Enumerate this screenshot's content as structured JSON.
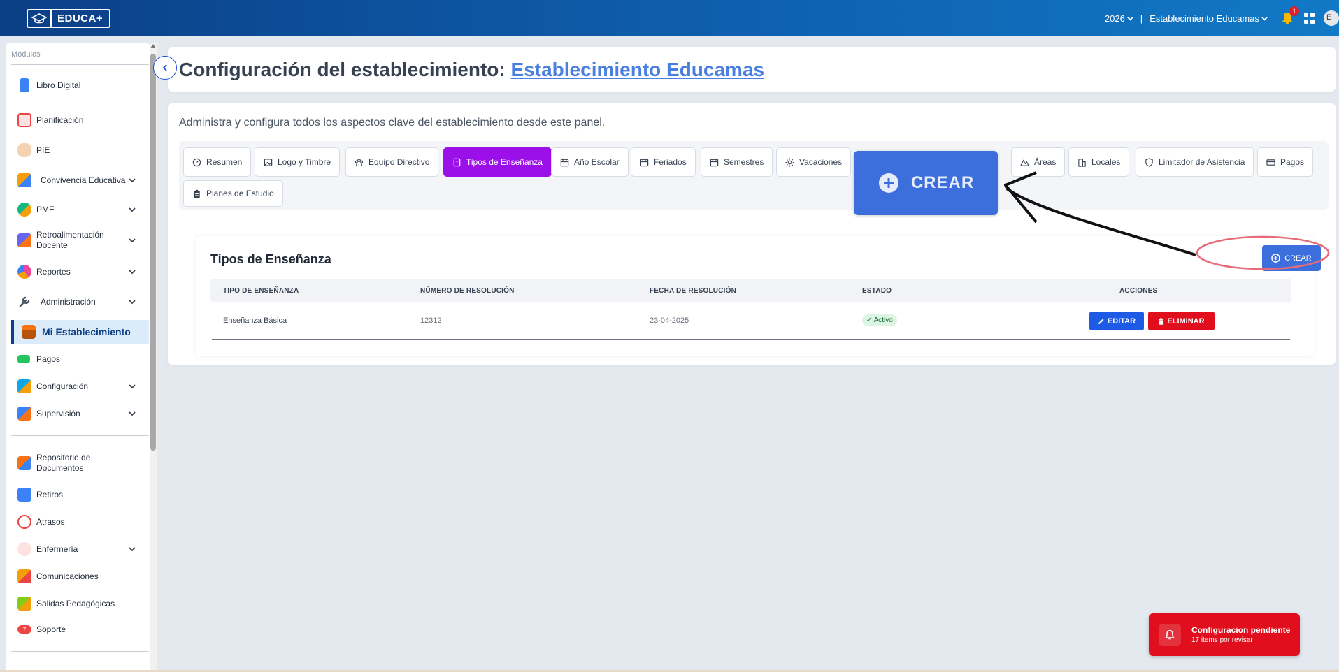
{
  "app": {
    "logo_text": "EDUCA+"
  },
  "topbar": {
    "year": "2026",
    "separator": "|",
    "establishment": "Establecimiento Educamas",
    "notification_count": "1",
    "avatar_initial": "E"
  },
  "sidebar": {
    "title": "Módulos",
    "items": [
      {
        "label": "Libro Digital",
        "icon": "book-icon",
        "color": "#3b82f6"
      },
      {
        "label": "Planificación",
        "icon": "calendar-icon",
        "color": "#ef4444"
      },
      {
        "label": "PIE",
        "icon": "hand-icon",
        "color": "#f3c7a1"
      },
      {
        "label": "Convivencia Educativa",
        "icon": "people-icon",
        "color": "#f59e0b"
      },
      {
        "label": "PME",
        "icon": "shapes-icon",
        "color": "#10b981"
      },
      {
        "label": "Retroalimentación Docente",
        "icon": "feedback-icon",
        "color": "#6366f1"
      },
      {
        "label": "Reportes",
        "icon": "pie-chart-icon",
        "color": "#ec4899"
      },
      {
        "label": "Administración",
        "icon": "wrench-icon",
        "color": "#4b5563"
      },
      {
        "label": "Mi Establecimiento",
        "icon": "school-icon",
        "color": "#f97316"
      },
      {
        "label": "Pagos",
        "icon": "money-icon",
        "color": "#22c55e"
      },
      {
        "label": "Configuración",
        "icon": "tools-icon",
        "color": "#0ea5e9"
      },
      {
        "label": "Supervisión",
        "icon": "supervision-icon",
        "color": "#3b82f6"
      },
      {
        "label": "Repositorio de Documentos",
        "icon": "box-icon",
        "color": "#f97316"
      },
      {
        "label": "Retiros",
        "icon": "exit-icon",
        "color": "#3b82f6"
      },
      {
        "label": "Atrasos",
        "icon": "clock-icon",
        "color": "#ef4444"
      },
      {
        "label": "Enfermería",
        "icon": "nurse-icon",
        "color": "#ef4444"
      },
      {
        "label": "Comunicaciones",
        "icon": "messages-icon",
        "color": "#f59e0b"
      },
      {
        "label": "Salidas Pedagógicas",
        "icon": "trip-icon",
        "color": "#84cc16"
      },
      {
        "label": "Soporte",
        "icon": "support-icon",
        "color": "#ef4444",
        "badge": "7"
      }
    ]
  },
  "header": {
    "title_prefix": "Configuración del establecimiento: ",
    "title_link": "Establecimiento Educamas"
  },
  "main": {
    "subtitle": "Administra y configura todos los aspectos clave del establecimiento desde este panel.",
    "tabs": [
      {
        "label": "Resumen",
        "icon": "gauge-icon"
      },
      {
        "label": "Logo y Timbre",
        "icon": "image-icon"
      },
      {
        "label": "Equipo Directivo",
        "icon": "team-icon"
      },
      {
        "label": "Tipos de Enseñanza",
        "icon": "book-icon",
        "active": true
      },
      {
        "label": "Año Escolar",
        "icon": "calendar-icon"
      },
      {
        "label": "Feriados",
        "icon": "calendar-icon"
      },
      {
        "label": "Semestres",
        "icon": "calendar-icon"
      },
      {
        "label": "Vacaciones",
        "icon": "sun-icon"
      },
      {
        "label": "Áreas",
        "icon": "mountain-icon"
      },
      {
        "label": "Locales",
        "icon": "building-icon"
      },
      {
        "label": "Limitador de Asistencia",
        "icon": "shield-icon"
      },
      {
        "label": "Pagos",
        "icon": "card-icon"
      },
      {
        "label": "Planes de Estudio",
        "icon": "clipboard-icon"
      }
    ],
    "big_create_label": "CREAR"
  },
  "section": {
    "title": "Tipos de Enseñanza",
    "create_label": "CREAR",
    "columns": [
      "TIPO DE ENSEÑANZA",
      "NÚMERO DE RESOLUCIÓN",
      "FECHA DE RESOLUCIÓN",
      "ESTADO",
      "ACCIONES"
    ],
    "rows": [
      {
        "tipo": "Enseñanza Básica",
        "numero": "12312",
        "fecha": "23-04-2025",
        "estado": "✓ Activo",
        "edit_label": "EDITAR",
        "delete_label": "ELIMINAR"
      }
    ]
  },
  "toast": {
    "title": "Configuracion pendiente",
    "text": "17 items por revisar"
  },
  "colors": {
    "brand": "#0b3f86",
    "accent": "#9b10e8",
    "primary_button": "#3c6fdc",
    "danger": "#e10f1e"
  }
}
